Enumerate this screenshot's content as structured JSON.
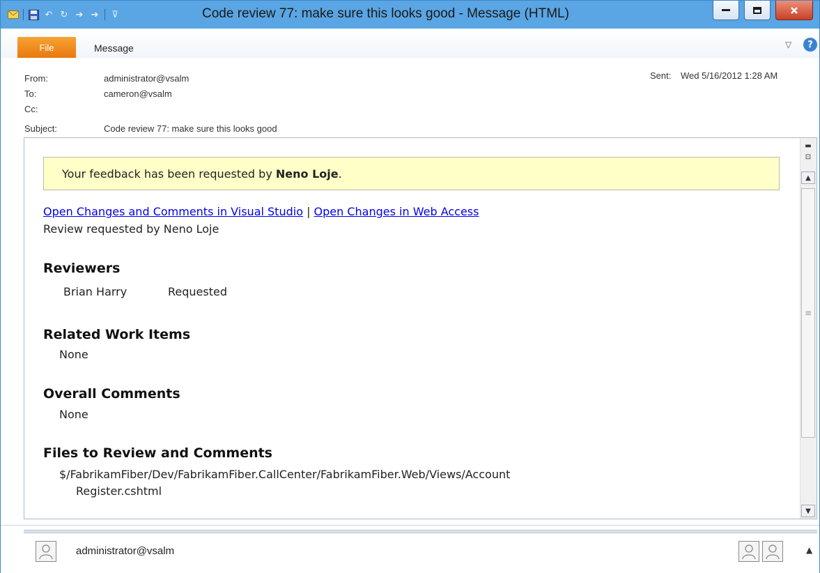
{
  "window": {
    "title": "Code review 77: make sure this looks good  -  Message (HTML)",
    "qat_icons": [
      "envelope-icon",
      "save-icon",
      "undo-icon",
      "redo-icon",
      "up-arrow-icon",
      "down-arrow-icon",
      "customize-qat-icon"
    ],
    "min_label": "−",
    "max_label": "□",
    "close_label": "x"
  },
  "ribbon": {
    "file_tab": "File",
    "message_tab": "Message",
    "help_label": "?"
  },
  "header": {
    "from_label": "From:",
    "from_value": "administrator@vsalm",
    "to_label": "To:",
    "to_value": "cameron@vsalm",
    "cc_label": "Cc:",
    "cc_value": "",
    "subject_label": "Subject:",
    "subject_value": "Code review 77: make sure this looks good",
    "sent_label": "Sent:",
    "sent_value": "Wed 5/16/2012 1:28 AM"
  },
  "message": {
    "banner_prefix": "Your feedback has been requested by ",
    "banner_name": "Neno Loje",
    "banner_suffix": ".",
    "link_vs": "Open Changes and Comments in Visual Studio",
    "link_sep": " | ",
    "link_web": "Open Changes in Web Access",
    "requested_by": "Review requested by Neno Loje",
    "reviewers_heading": "Reviewers",
    "reviewers": [
      {
        "name": "Brian Harry",
        "status": "Requested"
      }
    ],
    "work_items_heading": "Related Work Items",
    "work_items_value": "None",
    "overall_comments_heading": "Overall Comments",
    "overall_comments_value": "None",
    "files_heading": "Files to Review and Comments",
    "file_path": "$/FabrikamFiber/Dev/FabrikamFiber.CallCenter/FabrikamFiber.Web/Views/Account",
    "file_name": "Register.cshtml"
  },
  "people_pane": {
    "sender": "administrator@vsalm"
  },
  "colors": {
    "titlebar": "#5aa5e3",
    "file_tab": "#e8790f",
    "banner_bg": "#ffffc8",
    "link": "#0000ee",
    "close_button": "#c6402a"
  }
}
